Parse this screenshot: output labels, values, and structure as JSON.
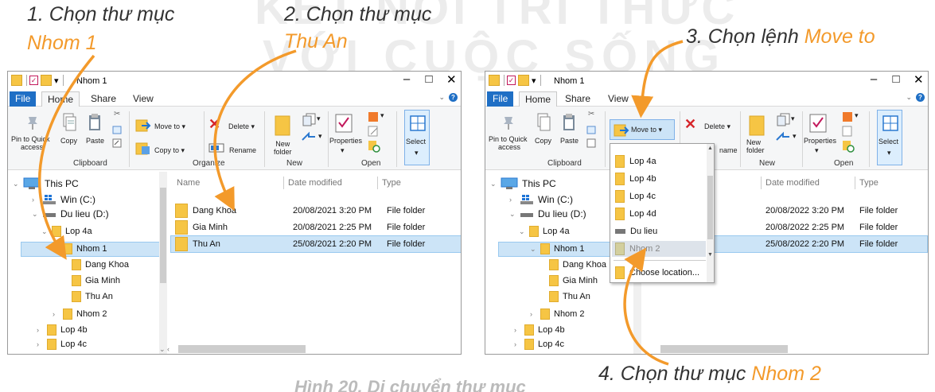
{
  "captions": {
    "step1_line1": "1. Chọn thư mục",
    "step1_line2": "Nhom 1",
    "step2_line1": "2. Chọn thư mục",
    "step2_line2": "Thu An",
    "step3_prefix": "3. Chọn lệnh ",
    "step3_highlight": "Move to",
    "step4_prefix": "4. Chọn thư mục ",
    "step4_highlight": "Nhom 2",
    "watermark_line1": "KẾT NỐI TRI THỨC",
    "watermark_line2": "VỚI CUỘC SỐNG",
    "figure_caption": "Hình 20. Di chuyển thư mục"
  },
  "colors": {
    "accent": "#f39a2b",
    "file_tab": "#1f6fc5",
    "selection": "#cce4f7"
  },
  "windows": [
    {
      "title": "Nhom 1",
      "tabs": [
        "File",
        "Home",
        "Share",
        "View"
      ],
      "ribbon": {
        "pin_line1": "Pin to Quick",
        "pin_line2": "access",
        "copy": "Copy",
        "paste": "Paste",
        "move_to": "Move to ▾",
        "copy_to": "Copy to ▾",
        "delete": "Delete ▾",
        "rename": "Rename",
        "new_folder_line1": "New",
        "new_folder_line2": "folder",
        "properties": "Properties",
        "select": "Select",
        "groups": [
          "Clipboard",
          "Organize",
          "New",
          "Open"
        ]
      },
      "tree": [
        "This PC",
        "Win (C:)",
        "Du lieu (D:)",
        "Lop 4a",
        "Nhom 1",
        "Dang Khoa",
        "Gia Minh",
        "Thu An",
        "Nhom 2",
        "Lop 4b",
        "Lop 4c"
      ],
      "columns": [
        "Name",
        "Date modified",
        "Type"
      ],
      "files": [
        {
          "name": "Dang Khoa",
          "date": "20/08/2021 3:20 PM",
          "type": "File folder"
        },
        {
          "name": "Gia Minh",
          "date": "20/08/2021 2:25 PM",
          "type": "File folder"
        },
        {
          "name": "Thu An",
          "date": "25/08/2021 2:20 PM",
          "type": "File folder"
        }
      ]
    },
    {
      "title": "Nhom 1",
      "tabs": [
        "File",
        "Home",
        "Share",
        "View"
      ],
      "ribbon": {
        "pin_line1": "Pin to Quick",
        "pin_line2": "access",
        "copy": "Copy",
        "paste": "Paste",
        "move_to": "Move to ▾",
        "delete": "Delete ▾",
        "rename_partial": "name",
        "new_folder_line1": "New",
        "new_folder_line2": "folder",
        "properties": "Properties",
        "select": "Select",
        "groups": [
          "Clipboard",
          "New",
          "Open"
        ]
      },
      "tree": [
        "This PC",
        "Win (C:)",
        "Du lieu (D:)",
        "Lop 4a",
        "Nhom 1",
        "Dang Khoa",
        "Gia Minh",
        "Thu An",
        "Nhom 2",
        "Lop 4b",
        "Lop 4c"
      ],
      "columns": [
        "Date modified",
        "Type"
      ],
      "files": [
        {
          "date": "20/08/2022 3:20 PM",
          "type": "File folder"
        },
        {
          "date": "20/08/2022 2:25 PM",
          "type": "File folder"
        },
        {
          "date": "25/08/2022 2:20 PM",
          "type": "File folder"
        }
      ],
      "move_menu": [
        "Lop 4a",
        "Lop 4b",
        "Lop 4c",
        "Lop 4d",
        "Du lieu",
        "Nhom 2",
        "Choose location..."
      ]
    }
  ],
  "window_controls": {
    "minimize": "–",
    "maximize": "□",
    "close": "✕",
    "help": "?",
    "collapse": "⌄"
  }
}
